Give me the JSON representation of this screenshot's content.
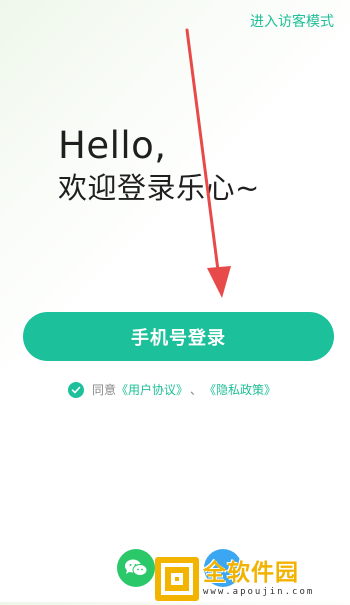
{
  "header": {
    "guest_mode_label": "进入访客模式"
  },
  "greeting": {
    "line1": "Hello,",
    "line2": "欢迎登录乐心~"
  },
  "login": {
    "phone_login_label": "手机号登录"
  },
  "agreement": {
    "prefix": "同意",
    "user_agreement": "《用户协议》",
    "separator": "、",
    "privacy_policy": "《隐私政策》",
    "checked": true
  },
  "social": {
    "wechat_icon": "wechat-icon",
    "other_icon": "other-login-icon"
  },
  "watermark": {
    "title": "全软件园",
    "domain": "www.apoujin.com"
  },
  "colors": {
    "accent": "#1cc09a",
    "link": "#1fbf98",
    "annotation_arrow": "#e84a4a",
    "watermark": "#f2b300"
  }
}
